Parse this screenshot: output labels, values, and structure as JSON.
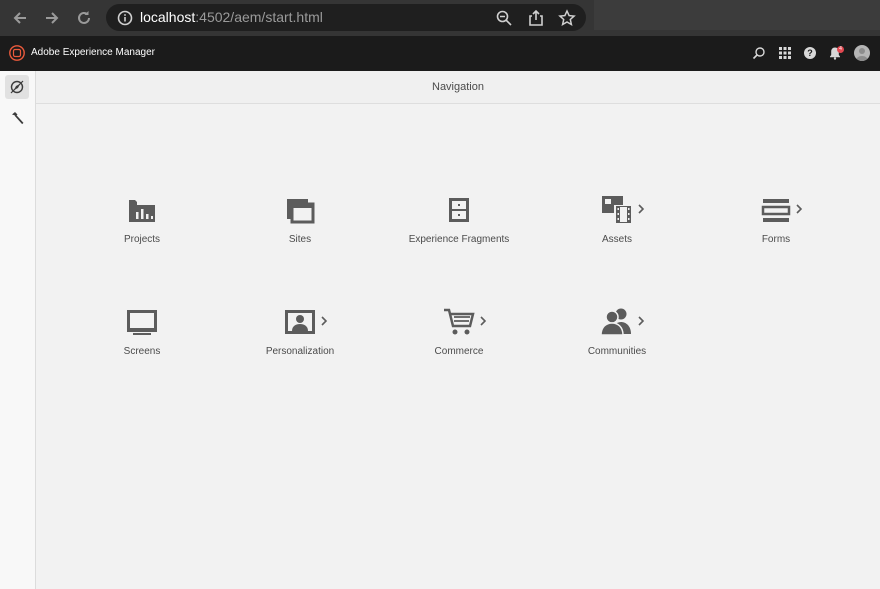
{
  "browser": {
    "url_host": "localhost",
    "url_path": ":4502/aem/start.html"
  },
  "app": {
    "title": "Adobe Experience Manager",
    "notification_count": "4"
  },
  "page": {
    "title": "Navigation"
  },
  "tiles": [
    {
      "label": "Projects",
      "icon": "projects-icon",
      "has_children": false
    },
    {
      "label": "Sites",
      "icon": "sites-icon",
      "has_children": false
    },
    {
      "label": "Experience Fragments",
      "icon": "experience-fragments-icon",
      "has_children": false
    },
    {
      "label": "Assets",
      "icon": "assets-icon",
      "has_children": true
    },
    {
      "label": "Forms",
      "icon": "forms-icon",
      "has_children": true
    },
    {
      "label": "Screens",
      "icon": "screens-icon",
      "has_children": false
    },
    {
      "label": "Personalization",
      "icon": "personalization-icon",
      "has_children": true
    },
    {
      "label": "Commerce",
      "icon": "commerce-icon",
      "has_children": true
    },
    {
      "label": "Communities",
      "icon": "communities-icon",
      "has_children": true
    }
  ],
  "colors": {
    "browser_chrome": "#353535",
    "aem_header": "#1b1b1b",
    "icon_gray": "#5c5c5c",
    "accent_red": "#e34850",
    "logo_orange": "#eb5a3c"
  }
}
